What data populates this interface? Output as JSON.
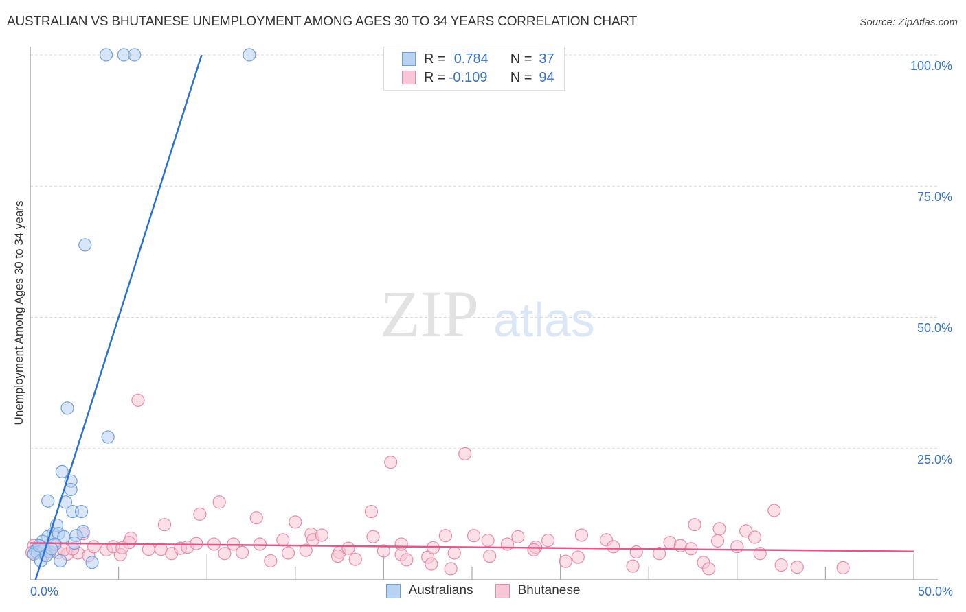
{
  "header": {
    "title": "AUSTRALIAN VS BHUTANESE UNEMPLOYMENT AMONG AGES 30 TO 34 YEARS CORRELATION CHART",
    "source": "Source: ZipAtlas.com"
  },
  "watermark": {
    "zip": "ZIP",
    "atlas": "atlas"
  },
  "legend": {
    "rows": [
      {
        "r_label": "R =",
        "r_value": "0.784",
        "n_label": "N =",
        "n_value": "37"
      },
      {
        "r_label": "R =",
        "r_value": "-0.109",
        "n_label": "N =",
        "n_value": "94"
      }
    ]
  },
  "colors": {
    "australians_fill": "#b8d2f2",
    "australians_stroke": "#6f9fdc",
    "australians_line": "#2a6fd4",
    "bhutanese_fill": "#f8c6d6",
    "bhutanese_stroke": "#e88aa8",
    "bhutanese_line": "#e0578a",
    "tick_label": "#3a74c8"
  },
  "chart_data": {
    "type": "scatter",
    "title": "AUSTRALIAN VS BHUTANESE UNEMPLOYMENT AMONG AGES 30 TO 34 YEARS CORRELATION CHART",
    "xlabel": "",
    "ylabel": "Unemployment Among Ages 30 to 34 years",
    "xlim": [
      0,
      50
    ],
    "ylim": [
      0,
      100
    ],
    "x_tick_labels": [
      "0.0%",
      "50.0%"
    ],
    "y_tick_labels": [
      "100.0%",
      "75.0%",
      "50.0%",
      "25.0%"
    ],
    "y_ticks": [
      100,
      75,
      50,
      25
    ],
    "x_minor_ticks": [
      5,
      10,
      15,
      20,
      25,
      30,
      35,
      40,
      45,
      50
    ],
    "grid": true,
    "legend_position": "bottom",
    "series": [
      {
        "name": "Australians",
        "R": 0.784,
        "N": 37,
        "trend": {
          "x": [
            0.3,
            9.7
          ],
          "y": [
            0,
            100
          ]
        },
        "points": [
          [
            4.3,
            100
          ],
          [
            5.3,
            100
          ],
          [
            5.9,
            100
          ],
          [
            12.4,
            100
          ],
          [
            3.1,
            63.8
          ],
          [
            2.1,
            32.7
          ],
          [
            4.4,
            27.2
          ],
          [
            1.8,
            20.6
          ],
          [
            2.3,
            18.8
          ],
          [
            2.3,
            17.2
          ],
          [
            1.0,
            15.0
          ],
          [
            2.0,
            14.8
          ],
          [
            2.4,
            13.0
          ],
          [
            2.9,
            13.0
          ],
          [
            1.5,
            10.4
          ],
          [
            3.0,
            9.2
          ],
          [
            1.0,
            8.2
          ],
          [
            1.3,
            8.8
          ],
          [
            1.6,
            8.8
          ],
          [
            2.6,
            8.4
          ],
          [
            1.9,
            8.2
          ],
          [
            0.7,
            7.3
          ],
          [
            0.6,
            6.3
          ],
          [
            0.5,
            5.8
          ],
          [
            0.3,
            5.5
          ],
          [
            0.4,
            5.2
          ],
          [
            0.2,
            4.9
          ],
          [
            0.8,
            5.9
          ],
          [
            1.1,
            5.3
          ],
          [
            1.4,
            6.8
          ],
          [
            0.6,
            3.6
          ],
          [
            1.7,
            3.6
          ],
          [
            2.5,
            7.0
          ],
          [
            3.5,
            3.3
          ],
          [
            0.9,
            4.6
          ],
          [
            1.2,
            5.9
          ],
          [
            0.5,
            6.5
          ]
        ]
      },
      {
        "name": "Bhutanese",
        "R": -0.109,
        "N": 94,
        "trend": {
          "x": [
            0,
            50
          ],
          "y": [
            7.0,
            5.4
          ]
        },
        "points": [
          [
            6.1,
            34.2
          ],
          [
            20.4,
            22.4
          ],
          [
            24.6,
            24.0
          ],
          [
            7.6,
            10.5
          ],
          [
            10.7,
            14.8
          ],
          [
            9.6,
            12.5
          ],
          [
            12.8,
            11.8
          ],
          [
            15.0,
            11.0
          ],
          [
            19.3,
            13.0
          ],
          [
            3.0,
            8.8
          ],
          [
            5.7,
            7.9
          ],
          [
            7.4,
            5.8
          ],
          [
            8.0,
            5.0
          ],
          [
            8.5,
            6.0
          ],
          [
            8.9,
            6.2
          ],
          [
            9.4,
            6.9
          ],
          [
            10.4,
            6.8
          ],
          [
            11.0,
            5.0
          ],
          [
            11.5,
            6.8
          ],
          [
            12.0,
            5.2
          ],
          [
            13.0,
            6.8
          ],
          [
            13.6,
            3.6
          ],
          [
            14.6,
            5.1
          ],
          [
            15.6,
            5.6
          ],
          [
            14.3,
            7.6
          ],
          [
            15.9,
            8.7
          ],
          [
            16.0,
            7.6
          ],
          [
            16.5,
            8.5
          ],
          [
            17.5,
            5.2
          ],
          [
            17.4,
            4.5
          ],
          [
            18.4,
            3.9
          ],
          [
            18.0,
            6.0
          ],
          [
            19.4,
            8.2
          ],
          [
            20.0,
            5.5
          ],
          [
            21.0,
            4.8
          ],
          [
            21.3,
            3.8
          ],
          [
            21.0,
            6.8
          ],
          [
            22.5,
            4.3
          ],
          [
            22.8,
            6.1
          ],
          [
            23.5,
            8.4
          ],
          [
            22.7,
            3.0
          ],
          [
            24.0,
            5.1
          ],
          [
            25.1,
            8.4
          ],
          [
            25.9,
            7.5
          ],
          [
            23.8,
            2.1
          ],
          [
            26.0,
            4.5
          ],
          [
            27.6,
            8.2
          ],
          [
            27.0,
            6.8
          ],
          [
            28.6,
            6.2
          ],
          [
            28.5,
            5.7
          ],
          [
            29.3,
            7.5
          ],
          [
            30.3,
            3.5
          ],
          [
            31.0,
            4.3
          ],
          [
            31.2,
            8.5
          ],
          [
            32.6,
            7.6
          ],
          [
            33.0,
            6.3
          ],
          [
            34.1,
            2.6
          ],
          [
            34.3,
            5.3
          ],
          [
            35.6,
            5.0
          ],
          [
            36.2,
            7.1
          ],
          [
            36.8,
            6.5
          ],
          [
            37.4,
            5.9
          ],
          [
            38.1,
            3.3
          ],
          [
            38.4,
            2.1
          ],
          [
            37.6,
            10.5
          ],
          [
            38.9,
            7.4
          ],
          [
            39.0,
            9.7
          ],
          [
            40.0,
            6.3
          ],
          [
            40.5,
            9.3
          ],
          [
            41.0,
            8.1
          ],
          [
            41.3,
            5.0
          ],
          [
            42.5,
            2.8
          ],
          [
            42.1,
            13.2
          ],
          [
            43.4,
            2.4
          ],
          [
            46.0,
            2.3
          ],
          [
            1.0,
            5.4
          ],
          [
            0.2,
            6.5
          ],
          [
            0.5,
            6.1
          ],
          [
            1.6,
            5.2
          ],
          [
            2.1,
            4.9
          ],
          [
            2.7,
            5.1
          ],
          [
            3.3,
            4.6
          ],
          [
            3.6,
            6.3
          ],
          [
            4.3,
            5.7
          ],
          [
            5.1,
            4.8
          ],
          [
            5.6,
            7.1
          ],
          [
            6.7,
            5.8
          ],
          [
            0.1,
            5.2
          ],
          [
            0.8,
            4.8
          ],
          [
            1.9,
            5.7
          ],
          [
            4.7,
            6.3
          ],
          [
            5.2,
            6.1
          ],
          [
            1.3,
            6.8
          ],
          [
            2.4,
            5.9
          ]
        ]
      }
    ]
  },
  "bottom_legend": {
    "items": [
      {
        "label": "Australians"
      },
      {
        "label": "Bhutanese"
      }
    ]
  }
}
